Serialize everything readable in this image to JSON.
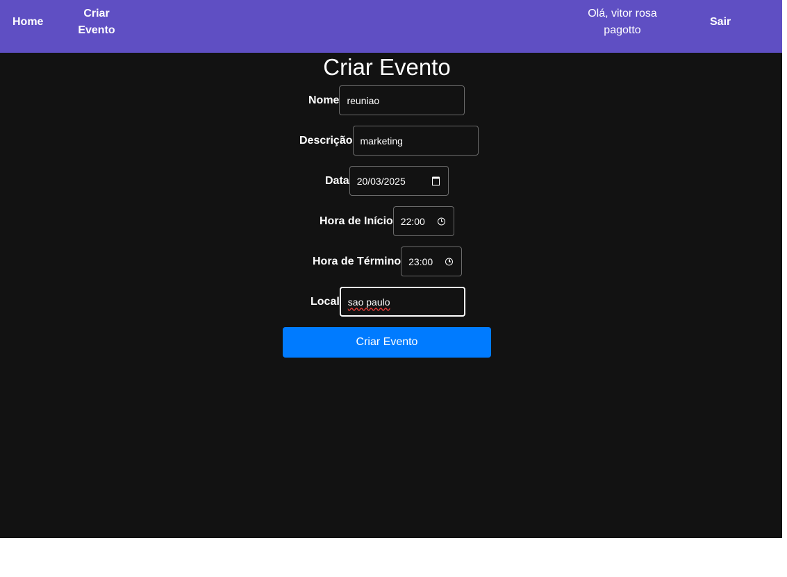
{
  "navbar": {
    "home_label": "Home",
    "criar_label": "Criar Evento",
    "greeting": "Olá, vitor rosa pagotto",
    "sair_label": "Sair",
    "background": "#5f4fc3"
  },
  "form": {
    "title": "Criar Evento",
    "nome": {
      "label": "Nome",
      "value": "reuniao"
    },
    "descricao": {
      "label": "Descrição",
      "value": "marketing"
    },
    "data": {
      "label": "Data",
      "value": "20/03/2025",
      "icon": "calendar-icon"
    },
    "hora_inicio": {
      "label": "Hora de Início",
      "value": "22:00",
      "icon": "clock-icon"
    },
    "hora_termino": {
      "label": "Hora de Término",
      "value": "23:00",
      "icon": "clock-icon"
    },
    "local": {
      "label": "Local",
      "value": "sao paulo"
    },
    "submit_label": "Criar Evento",
    "accent": "#007bff",
    "page_background": "#121212"
  }
}
